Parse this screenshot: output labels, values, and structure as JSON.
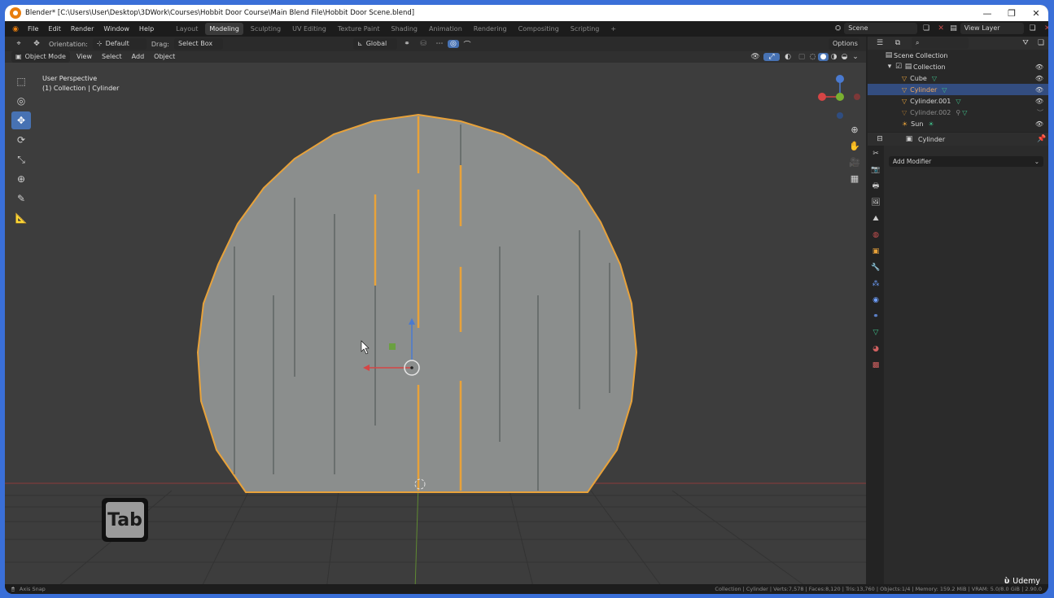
{
  "window": {
    "title": "Blender* [C:\\Users\\User\\Desktop\\3DWork\\Courses\\Hobbit Door Course\\Main Blend File\\Hobbit Door Scene.blend]",
    "minimize": "—",
    "maximize": "❐",
    "close": "✕"
  },
  "menu": [
    "File",
    "Edit",
    "Render",
    "Window",
    "Help"
  ],
  "workspaces": [
    "Layout",
    "Modeling",
    "Sculpting",
    "UV Editing",
    "Texture Paint",
    "Shading",
    "Animation",
    "Rendering",
    "Compositing",
    "Scripting"
  ],
  "active_workspace": "Modeling",
  "add_workspace": "+",
  "scene": "Scene",
  "view_layer": "View Layer",
  "header": {
    "orientation_label": "Orientation:",
    "orientation_value": "Default",
    "drag_label": "Drag:",
    "drag_value": "Select Box",
    "transform_value": "Global",
    "options": "Options"
  },
  "header2": {
    "mode": "Object Mode",
    "view": "View",
    "select": "Select",
    "add": "Add",
    "object": "Object"
  },
  "viewport": {
    "line1": "User Perspective",
    "line2": "(1) Collection | Cylinder",
    "tab_key": "Tab"
  },
  "outliner": {
    "root": "Scene Collection",
    "collection": "Collection",
    "items": [
      {
        "name": "Cube",
        "selected": false
      },
      {
        "name": "Cylinder",
        "selected": true
      },
      {
        "name": "Cylinder.001",
        "selected": false
      },
      {
        "name": "Cylinder.002",
        "selected": false
      },
      {
        "name": "Sun",
        "selected": false
      }
    ]
  },
  "properties": {
    "object": "Cylinder",
    "add_modifier": "Add Modifier"
  },
  "status": {
    "left": "Axis Snap",
    "right": "Collection | Cylinder | Verts:7,578 | Faces:8,120 | Tris:13,760 | Objects:1/4 | Memory: 159.2 MiB | VRAM: 5.0/8.0 GiB | 2.90.0"
  },
  "watermark": "Udemy",
  "colors": {
    "selection_orange": "#e8a23a",
    "active_blue": "#4772b3",
    "mesh_grey": "#8a8d8c",
    "viewport_bg": "#3d3d3d"
  }
}
